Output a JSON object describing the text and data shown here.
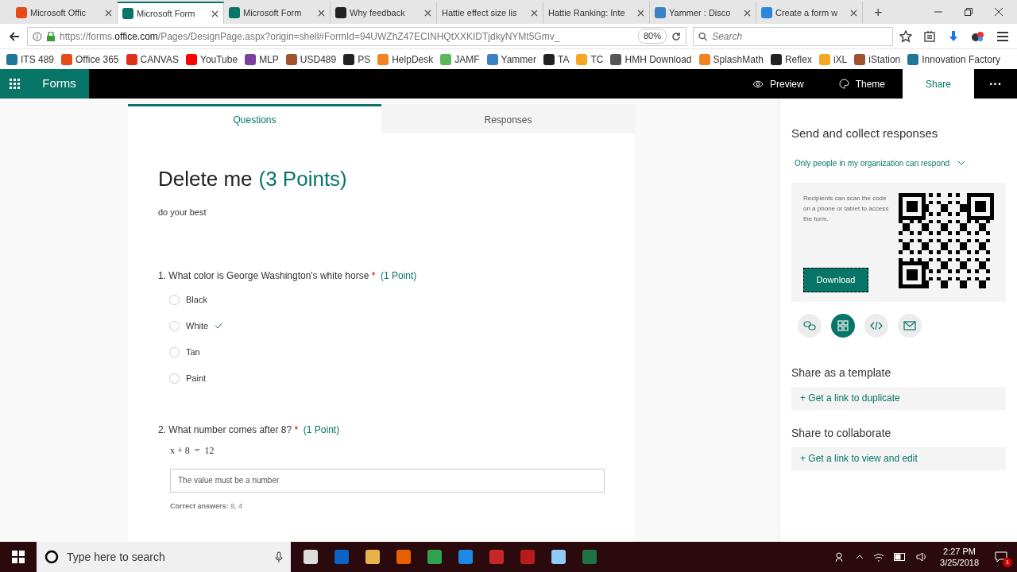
{
  "browser": {
    "tabs": [
      {
        "title": "Microsoft Offic",
        "selected": false
      },
      {
        "title": "Microsoft Form",
        "selected": true
      },
      {
        "title": "Microsoft Form",
        "selected": false
      },
      {
        "title": "Why feedback",
        "selected": false
      },
      {
        "title": "Hattie effect size lis",
        "selected": false
      },
      {
        "title": "Hattie Ranking: Inte",
        "selected": false
      },
      {
        "title": "Yammer : Disco",
        "selected": false
      },
      {
        "title": "Create a form w",
        "selected": false
      }
    ],
    "new_tab": "+",
    "url_prefix": "https://forms.",
    "url_domain": "office.com",
    "url_path": "/Pages/DesignPage.aspx?origin=shell#FormId=94UWZhZ47ECINHQtXXKIDTjdkyNYMt5Gmv_",
    "zoom": "80%",
    "search_placeholder": "Search",
    "bookmarks": [
      "ITS 489",
      "Office 365",
      "CANVAS",
      "YouTube",
      "MLP",
      "USD489",
      "PS",
      "HelpDesk",
      "JAMF",
      "Yammer",
      "TA",
      "TC",
      "HMH Download",
      "SplashMath",
      "Reflex",
      "iXL",
      "iStation",
      "Innovation Factory"
    ]
  },
  "app": {
    "name": "Forms",
    "actions": [
      {
        "label": "Preview",
        "selected": false
      },
      {
        "label": "Theme",
        "selected": false
      },
      {
        "label": "Share",
        "selected": true
      }
    ],
    "more": "···"
  },
  "form": {
    "tabs": [
      {
        "label": "Questions",
        "selected": true
      },
      {
        "label": "Responses",
        "selected": false
      }
    ],
    "title": "Delete me",
    "points": "(3 Points)",
    "description": "do your best",
    "questions": [
      {
        "kind": "choice",
        "number": "1.",
        "text": "What color is George Washington's white horse",
        "required": "*",
        "points": "(1 Point)",
        "options": [
          {
            "label": "Black",
            "selected": false,
            "correct": false
          },
          {
            "label": "White",
            "selected": false,
            "correct": true
          },
          {
            "label": "Tan",
            "selected": false,
            "correct": false
          },
          {
            "label": "Paint",
            "selected": false,
            "correct": false
          }
        ]
      },
      {
        "kind": "text",
        "number": "2.",
        "text": "What number comes after 8?",
        "required": "*",
        "points": "(1 Point)",
        "formula": "x + 8  =  12",
        "placeholder": "The value must be a number",
        "answers": "**Correct answers:** 9, 4"
      }
    ]
  },
  "share": {
    "title": "Send and collect responses",
    "audience": "Only people in my organization can respond",
    "qr_text": "Recipients can scan the code on a phone or tablet to access the form.",
    "download": "Download",
    "methods": [
      {
        "kind": "link",
        "selected": false
      },
      {
        "kind": "qr",
        "selected": true
      },
      {
        "kind": "embed",
        "selected": false
      },
      {
        "kind": "email",
        "selected": false
      }
    ],
    "plus": "+",
    "template_title": "Share as a template",
    "template_link": "Get a link to duplicate",
    "collab_title": "Share to collaborate",
    "collab_link": "Get a link to view and edit"
  },
  "taskbar": {
    "search_placeholder": "Type here to search",
    "time": "2:27 PM",
    "date": "3/25/2018",
    "notifications": "1"
  }
}
